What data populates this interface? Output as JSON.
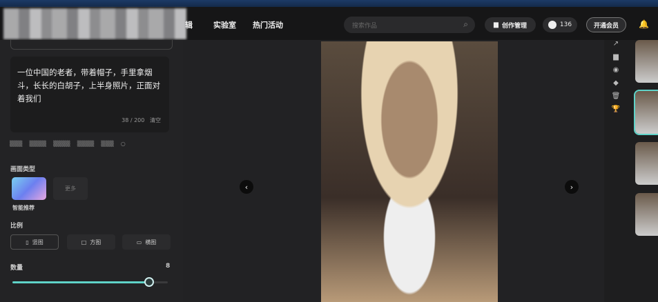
{
  "header": {
    "nav": [
      "实验室",
      "热门活动"
    ],
    "search_placeholder": "搜索作品",
    "create_manage": "创作管理",
    "points": "136",
    "vip": "开通会员"
  },
  "left": {
    "prompt": "一位中国的老者，带着帽子，手里拿烟斗，长长的白胡子，上半身照片，正面对着我们",
    "char_count": "38 / 200",
    "clear": "清空",
    "image_type_label": "画面类型",
    "style_smart": "智能推荐",
    "style_other": "更多",
    "ratio_label": "比例",
    "ratios": [
      "竖图",
      "方图",
      "横图"
    ],
    "count_label": "数量",
    "count_value": "8",
    "count_fraction": 0.88
  },
  "viewer": {
    "prev": "‹",
    "next": "›"
  }
}
